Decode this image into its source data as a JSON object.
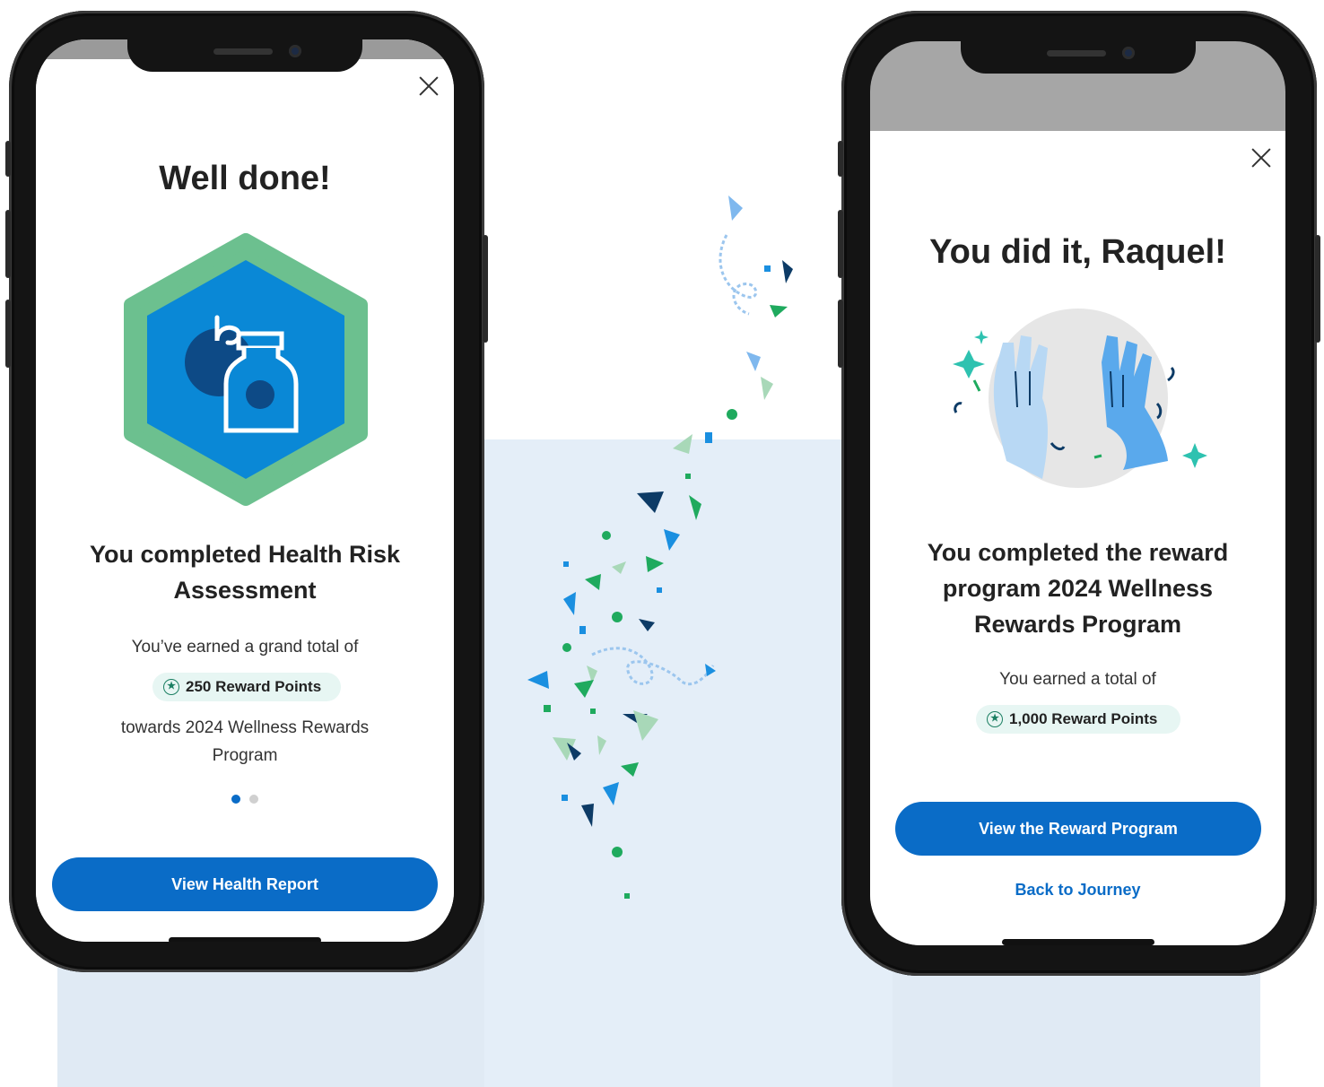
{
  "left_screen": {
    "close_label": "Close",
    "title": "Well done!",
    "badge_icon": "medicine-bottle-hexagon-badge-icon",
    "completion_text_line1": "You completed Health Risk",
    "completion_text_line2": "Assessment",
    "earned_text": "You’ve earned a grand total of",
    "points": "250 Reward Points",
    "towards_text_line1": "towards 2024 Wellness Rewards",
    "towards_text_line2": "Program",
    "pagination": {
      "total": 2,
      "active": 1
    },
    "primary_button": "View Health Report"
  },
  "right_screen": {
    "close_label": "Close",
    "title": "You did it, Raquel!",
    "illustration_icon": "high-five-hands-icon",
    "completion_text_line1": "You completed the reward",
    "completion_text_line2": "program 2024 Wellness",
    "completion_text_line3": "Rewards Program",
    "earned_text": "You earned a total of",
    "points": "1,000 Reward Points",
    "primary_button": "View the Reward Program",
    "secondary_link": "Back to Journey"
  },
  "colors": {
    "primary_blue": "#0a6cc7",
    "badge_green": "#6cc08f",
    "badge_blue": "#0a88d6",
    "pill_bg": "#e7f6f3",
    "confetti": [
      "#0d3b66",
      "#1a8fe0",
      "#7fb8ee",
      "#1faa5e",
      "#a8d8b8"
    ]
  }
}
